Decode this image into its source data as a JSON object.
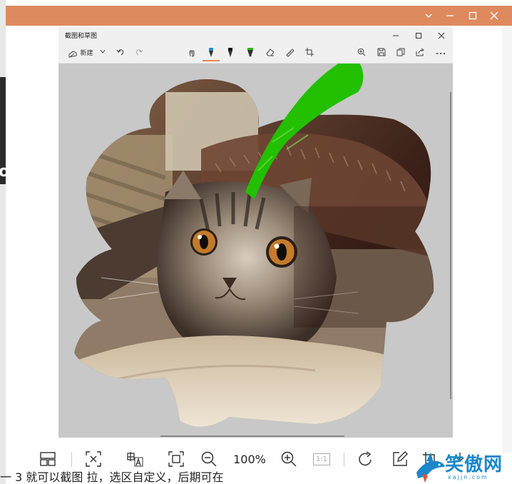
{
  "snip_app": {
    "title": "截图和草图",
    "toolbar": {
      "new_label": "新建",
      "icons": [
        "new-snip-icon",
        "chevron-down-icon",
        "undo-icon",
        "redo-icon",
        "touch-writing-icon",
        "ballpoint-pen-icon",
        "pencil-icon",
        "highlighter-icon",
        "eraser-icon",
        "ruler-icon",
        "crop-icon",
        "zoom-icon",
        "save-icon",
        "copy-icon",
        "share-icon",
        "more-icon"
      ]
    },
    "window_controls": [
      "minimize",
      "maximize",
      "close"
    ]
  },
  "viewer": {
    "zoom_label": "100%",
    "actual_size_label": "1:1",
    "toolbar_icons": [
      "layout-icon",
      "remove-background-icon",
      "ocr-text-icon",
      "fit-screen-icon",
      "zoom-out-icon",
      "zoom-in-icon",
      "actual-size-icon",
      "rotate-icon",
      "edit-icon",
      "crop-icon",
      "more-icon"
    ]
  },
  "watermark": {
    "text": "笑傲网",
    "url": "xajjn.com"
  },
  "background": {
    "stray_text": "一 3 就可以截图 拉，选区自定义，后期可在",
    "left_letter": "o"
  },
  "colors": {
    "title_bar": "#de8a5e",
    "canvas_bg": "#c8c8c8",
    "pen_accent": "#22c000",
    "pen_active": "#1a8fd6",
    "watermark": "#1a88c9"
  }
}
